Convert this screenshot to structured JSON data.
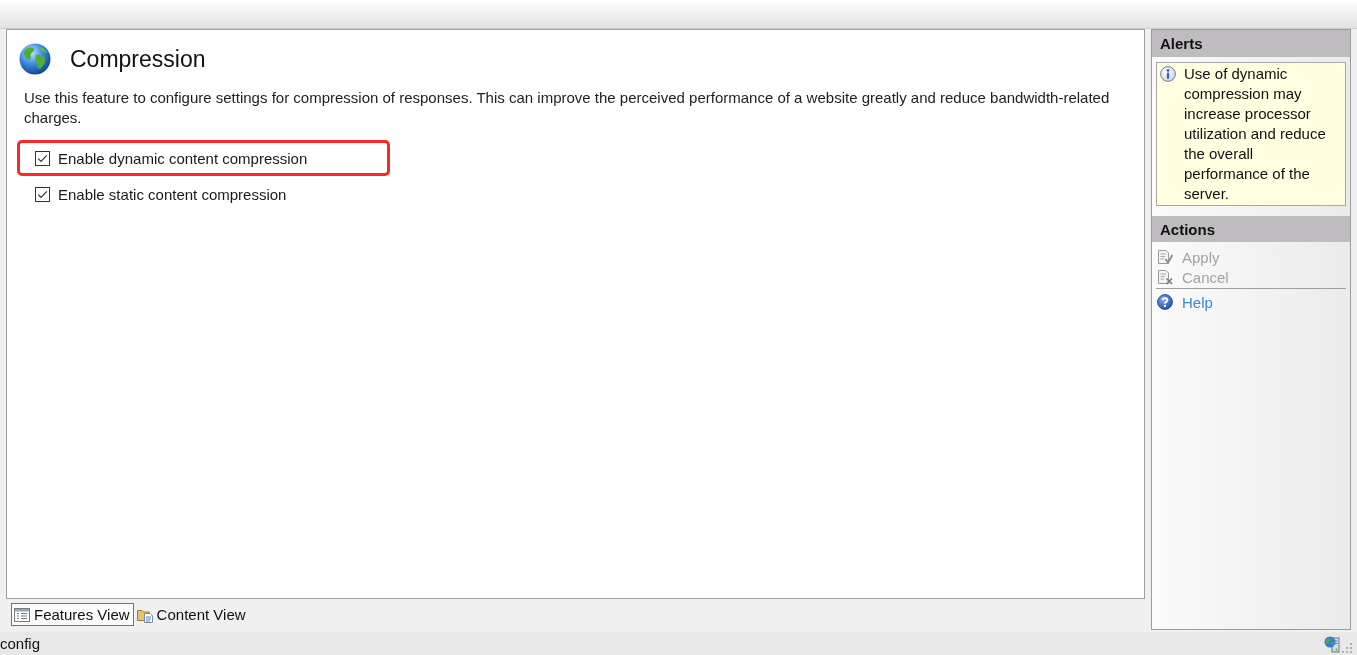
{
  "feature": {
    "title": "Compression",
    "description": "Use this feature to configure settings for compression of responses. This can improve the perceived performance of a website greatly and reduce bandwidth-related charges."
  },
  "options": [
    {
      "label": "Enable dynamic content compression",
      "checked": true,
      "highlighted": true
    },
    {
      "label": "Enable static content compression",
      "checked": true,
      "highlighted": false
    }
  ],
  "view_tabs": [
    {
      "kind": "features",
      "label": "Features View",
      "selected": true
    },
    {
      "kind": "content",
      "label": "Content View",
      "selected": false
    }
  ],
  "alerts": {
    "title": "Alerts",
    "items": [
      {
        "kind": "info",
        "text": "Use of dynamic compression may increase processor utilization and reduce the overall performance of the server."
      }
    ]
  },
  "actions": {
    "title": "Actions",
    "groups": [
      {
        "items": [
          {
            "kind": "apply",
            "label": "Apply",
            "disabled": true
          },
          {
            "kind": "cancel",
            "label": "Cancel",
            "disabled": true
          }
        ]
      },
      {
        "items": [
          {
            "kind": "help",
            "label": "Help",
            "disabled": false
          }
        ]
      }
    ]
  },
  "status_bar": {
    "text": "config"
  }
}
